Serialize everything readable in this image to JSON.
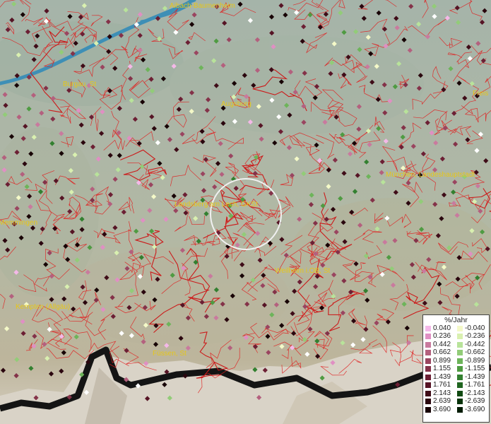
{
  "map": {
    "cities": [
      {
        "name": "Aibach-Baumenheim"
      },
      {
        "name": "Burgau, St"
      },
      {
        "name": "Augsburg"
      },
      {
        "name": "Freis"
      },
      {
        "name": "München, Landeshauptstadt"
      },
      {
        "name": "Landsberg am Lech, GKSt"
      },
      {
        "name": "Memmingen"
      },
      {
        "name": "Weilheim i.OB, St"
      },
      {
        "name": "Kempten (Allgäu)"
      },
      {
        "name": "Füssen, St"
      }
    ]
  },
  "legend": {
    "title": "%/Jahr",
    "positive": [
      {
        "label": "0.040",
        "color": "#f4b8e8"
      },
      {
        "label": "0.236",
        "color": "#e08fc3"
      },
      {
        "label": "0.442",
        "color": "#c97a9e"
      },
      {
        "label": "0.662",
        "color": "#b4607e"
      },
      {
        "label": "0.899",
        "color": "#9a4560"
      },
      {
        "label": "1.155",
        "color": "#843249"
      },
      {
        "label": "1.439",
        "color": "#6c1f34"
      },
      {
        "label": "1.761",
        "color": "#561425"
      },
      {
        "label": "2.143",
        "color": "#3f0c18"
      },
      {
        "label": "2.639",
        "color": "#2a060e"
      },
      {
        "label": "3.690",
        "color": "#170205"
      }
    ],
    "negative": [
      {
        "label": "-0.040",
        "color": "#f4f9c8"
      },
      {
        "label": "-0.236",
        "color": "#d9f0b0"
      },
      {
        "label": "-0.442",
        "color": "#b8e39a"
      },
      {
        "label": "-0.662",
        "color": "#92cc78"
      },
      {
        "label": "-0.899",
        "color": "#6db45a"
      },
      {
        "label": "-1.155",
        "color": "#4f9b42"
      },
      {
        "label": "-1.439",
        "color": "#338030"
      },
      {
        "label": "-1.761",
        "color": "#1f6520"
      },
      {
        "label": "-2.143",
        "color": "#114a12"
      },
      {
        "label": "-2.639",
        "color": "#07330a"
      },
      {
        "label": "-3.690",
        "color": "#021c04"
      }
    ]
  }
}
